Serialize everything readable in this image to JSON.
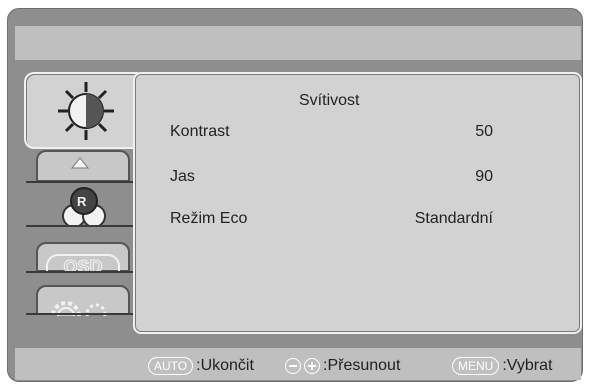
{
  "menu": {
    "title": "Svítivost",
    "rows": [
      {
        "label": "Kontrast",
        "value": "50"
      },
      {
        "label": "Jas",
        "value": "90"
      },
      {
        "label": "Režim Eco",
        "value": "Standardní"
      }
    ]
  },
  "tabs": [
    {
      "icon": "brightness-sun-icon"
    },
    {
      "icon": "picture-triangle-icon"
    },
    {
      "icon": "color-rgb-icon"
    },
    {
      "icon": "osd-icon"
    },
    {
      "icon": "settings-gears-icon"
    }
  ],
  "tab_texts": {
    "osd": "OSD"
  },
  "footer": {
    "auto_key": "AUTO",
    "auto_label": ":Ukončit",
    "move_label": ":Přesunout",
    "menu_key": "MENU",
    "menu_label": ":Vybrat"
  },
  "colors": {
    "frame": "#8e8e8e",
    "panel": "#d2d2d2",
    "bars": "#bfbfbf"
  }
}
